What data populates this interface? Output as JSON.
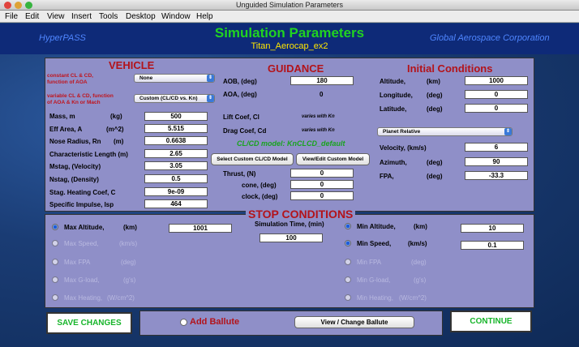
{
  "window_title": "Unguided Simulation Parameters",
  "menu": [
    "File",
    "Edit",
    "View",
    "Insert",
    "Tools",
    "Desktop",
    "Window",
    "Help"
  ],
  "header": {
    "left": "HyperPASS",
    "title": "Simulation Parameters",
    "subtitle": "Titan_Aerocap_ex2",
    "right": "Global Aerospace Corporation"
  },
  "vehicle": {
    "title": "VEHICLE",
    "const_label": "constant CL & CD,\nfunction of AOA",
    "const_value": "None",
    "var_label": "variable CL & CD, function\nof AOA & Kn or Mach",
    "var_value": "Custom (CL/CD vs. Kn)",
    "fields": [
      {
        "label": "Mass, m",
        "unit": "(kg)",
        "value": "500"
      },
      {
        "label": "Eff Area, A",
        "unit": "(m^2)",
        "value": "5.515"
      },
      {
        "label": "Nose Radius, Rn",
        "unit": "(m)",
        "value": "0.6638"
      },
      {
        "label": "Characteristic Length (m)",
        "unit": "",
        "value": "2.65"
      },
      {
        "label": "Mstag, (Velocity)",
        "unit": "",
        "value": "3.05"
      },
      {
        "label": "Nstag, (Density)",
        "unit": "",
        "value": "0.5"
      },
      {
        "label": "Stag. Heating Coef, C",
        "unit": "",
        "value": "9e-09"
      },
      {
        "label": "Specific Impulse, Isp",
        "unit": "",
        "value": "464"
      }
    ]
  },
  "guidance": {
    "title": "GUIDANCE",
    "aob_label": "AOB, (deg)",
    "aob_value": "180",
    "aoa_label": "AOA, (deg)",
    "aoa_value": "0",
    "lift_label": "Lift Coef, Cl",
    "lift_value": "varies with Kn",
    "drag_label": "Drag Coef, Cd",
    "drag_value": "varies with Kn",
    "model_text": "CL/CD model: KnCLCD_default",
    "select_btn": "Select Custom CL/CD Model",
    "view_btn": "View/Edit Custom Model",
    "thrust_label": "Thrust,  (N)",
    "thrust_value": "0",
    "cone_label": "cone, (deg)",
    "cone_value": "0",
    "clock_label": "clock, (deg)",
    "clock_value": "0"
  },
  "initial": {
    "title": "Initial Conditions",
    "alt_label": "Altitude,",
    "alt_unit": "(km)",
    "alt_value": "1000",
    "lon_label": "Longitude,",
    "lon_unit": "(deg)",
    "lon_value": "0",
    "lat_label": "Latitude,",
    "lat_unit": "(deg)",
    "lat_value": "0",
    "frame_value": "Planet Relative",
    "vel_label": "Velocity, (km/s)",
    "vel_value": "6",
    "az_label": "Azimuth,",
    "az_unit": "(deg)",
    "az_value": "90",
    "fpa_label": "FPA,",
    "fpa_unit": "(deg)",
    "fpa_value": "-33.3"
  },
  "stop": {
    "title": "STOP CONDITIONS",
    "sim_time_label": "Simulation Time,  (min)",
    "sim_time_value": "100",
    "left": [
      {
        "label": "Max Altitude,",
        "unit": "(km)",
        "value": "1001",
        "on": true
      },
      {
        "label": "Max Speed,",
        "unit": "(km/s)",
        "on": false
      },
      {
        "label": "Max FPA",
        "unit": "(deg)",
        "on": false
      },
      {
        "label": "Max G-load,",
        "unit": "(g's)",
        "on": false
      },
      {
        "label": "Max Heating,",
        "unit": "(W/cm^2)",
        "on": false
      }
    ],
    "right": [
      {
        "label": "Min Altitude,",
        "unit": "(km)",
        "value": "10",
        "on": true
      },
      {
        "label": "Min Speed,",
        "unit": "(km/s)",
        "value": "0.1",
        "on": true
      },
      {
        "label": "Min FPA",
        "unit": "(deg)",
        "on": false
      },
      {
        "label": "Min G-load,",
        "unit": "(g's)",
        "on": false
      },
      {
        "label": "Min Heating,",
        "unit": "(W/cm^2)",
        "on": false
      }
    ]
  },
  "bottom": {
    "save": "SAVE CHANGES",
    "add_ballute": "Add Ballute",
    "view_ballute": "View / Change Ballute",
    "continue": "CONTINUE"
  }
}
